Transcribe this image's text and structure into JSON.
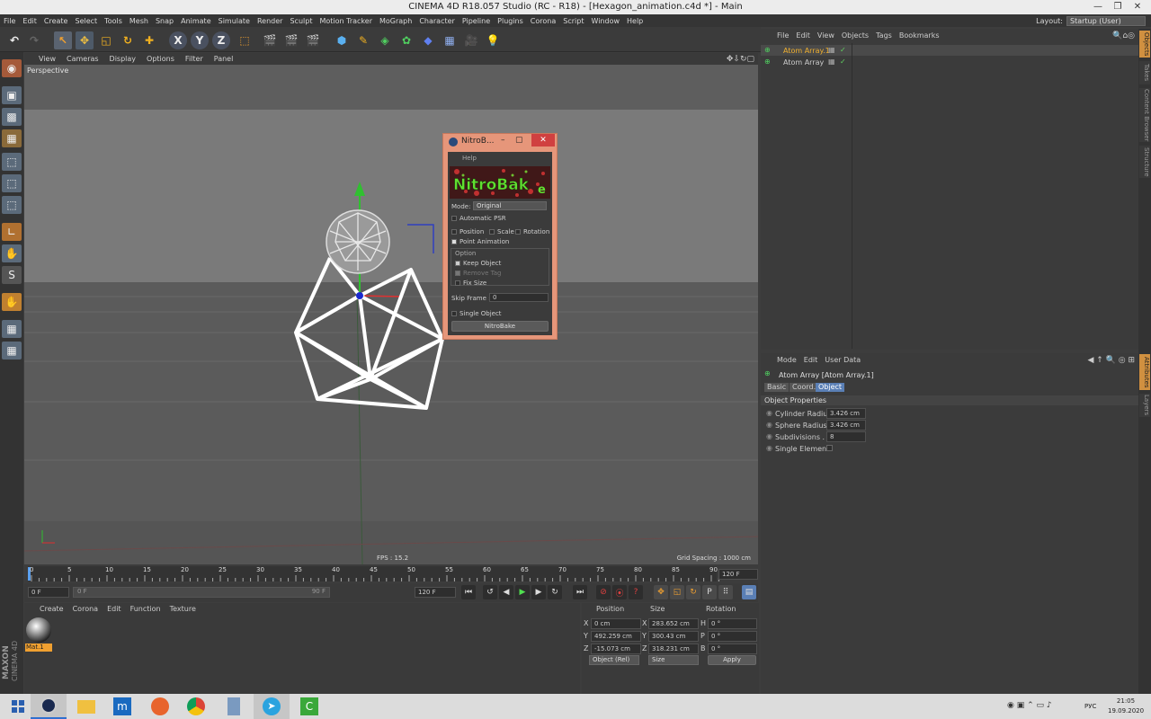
{
  "window": {
    "title": "CINEMA 4D R18.057 Studio (RC - R18) - [Hexagon_animation.c4d *] - Main"
  },
  "menu": [
    "File",
    "Edit",
    "Create",
    "Select",
    "Tools",
    "Mesh",
    "Snap",
    "Animate",
    "Simulate",
    "Render",
    "Sculpt",
    "Motion Tracker",
    "MoGraph",
    "Character",
    "Pipeline",
    "Plugins",
    "Corona",
    "Script",
    "Window",
    "Help"
  ],
  "layout": {
    "label": "Layout:",
    "value": "Startup (User)"
  },
  "viewport": {
    "menu": [
      "View",
      "Cameras",
      "Display",
      "Options",
      "Filter",
      "Panel"
    ],
    "label": "Perspective",
    "fps": "FPS : 15.2",
    "grid": "Grid Spacing : 1000 cm"
  },
  "timeline": {
    "ticks": [
      "0",
      "5",
      "10",
      "15",
      "20",
      "25",
      "30",
      "35",
      "40",
      "45",
      "50",
      "55",
      "60",
      "65",
      "70",
      "75",
      "80",
      "85",
      "90"
    ],
    "end": "120 F",
    "start_field": "0 F",
    "range_start": "0 F",
    "range_end": "90 F",
    "end_field": "120 F"
  },
  "material": {
    "menu": [
      "Create",
      "Corona",
      "Edit",
      "Function",
      "Texture"
    ],
    "name": "Mat.1"
  },
  "maxon": {
    "brand": "MAXON",
    "product": "CINEMA 4D"
  },
  "coords": {
    "headers": [
      "Position",
      "Size",
      "Rotation"
    ],
    "rows": [
      {
        "axis": "X",
        "pos": "0 cm",
        "saxis": "X",
        "size": "283.652 cm",
        "raxis": "H",
        "rot": "0 °"
      },
      {
        "axis": "Y",
        "pos": "492.259 cm",
        "saxis": "Y",
        "size": "300.43 cm",
        "raxis": "P",
        "rot": "0 °"
      },
      {
        "axis": "Z",
        "pos": "-15.073 cm",
        "saxis": "Z",
        "size": "318.231 cm",
        "raxis": "B",
        "rot": "0 °"
      }
    ],
    "mode": "Object (Rel)",
    "size_mode": "Size",
    "apply": "Apply"
  },
  "objects": {
    "menu": [
      "File",
      "Edit",
      "View",
      "Objects",
      "Tags",
      "Bookmarks"
    ],
    "items": [
      "Atom Array.1",
      "Atom Array"
    ]
  },
  "attributes": {
    "menu": [
      "Mode",
      "Edit",
      "User Data"
    ],
    "title": "Atom Array [Atom Array.1]",
    "tabs": [
      "Basic",
      "Coord.",
      "Object"
    ],
    "section": "Object Properties",
    "props": [
      {
        "label": "Cylinder Radius",
        "value": "3.426 cm"
      },
      {
        "label": "Sphere Radius",
        "value": "3.426 cm"
      },
      {
        "label": "Subdivisions . .",
        "value": "8"
      },
      {
        "label": "Single Elements",
        "value": ""
      }
    ]
  },
  "sidetabs": [
    "Objects",
    "Takes",
    "Content Browser",
    "Structure",
    "Attributes",
    "Layers"
  ],
  "nitro": {
    "title": "NitroB...",
    "menu": "Help",
    "logo": "NitroBake",
    "mode_label": "Mode:",
    "mode_value": "Original",
    "automatic_psr": "Automatic PSR",
    "position": "Position",
    "scale": "Scale",
    "rotation": "Rotation",
    "point_animation": "Point Animation",
    "option": "Option",
    "keep_object": "Keep Object",
    "remove_tag": "Remove Tag",
    "fix_size": "Fix Size",
    "skip_label": "Skip Frame :",
    "skip_value": "0",
    "single_object": "Single Object",
    "bake_button": "NitroBake"
  },
  "taskbar": {
    "lang": "РУС",
    "time": "21:05",
    "date": "19.09.2020"
  },
  "colors": {
    "accent": "#f0a030",
    "dialog": "#e6967a",
    "selected_tab": "#5a7fb5"
  }
}
